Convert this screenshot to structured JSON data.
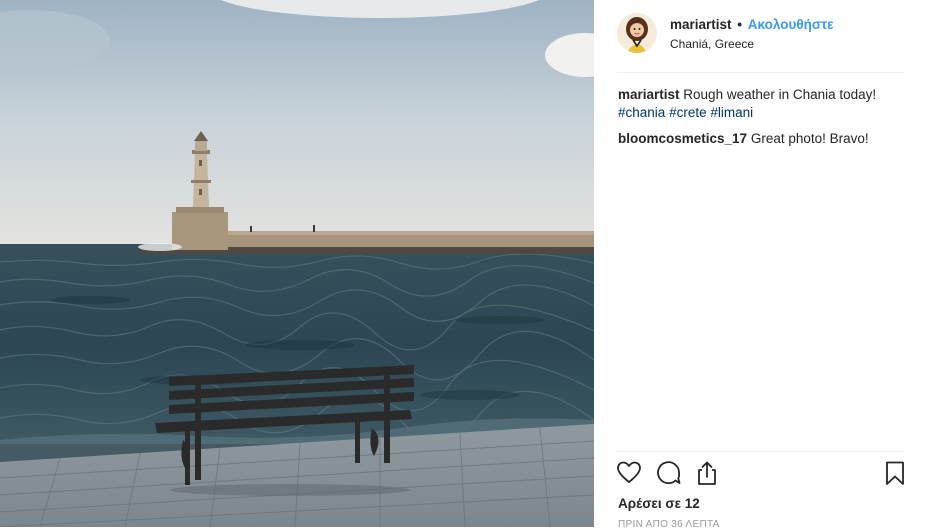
{
  "post": {
    "author": "mariartist",
    "follow_label": "Ακολουθήστε",
    "separator": "•",
    "location": "Chaniá, Greece"
  },
  "comments": [
    {
      "user": "mariartist",
      "text": "Rough weather in Chania today!",
      "tags": [
        "#chania",
        "#crete",
        "#limani"
      ]
    },
    {
      "user": "bloomcosmetics_17",
      "text": "Great photo! Bravo!"
    }
  ],
  "likes_label": "Αρέσει σε 12",
  "timestamp": "ΠΡΙΝ ΑΠΟ 36 ΛΕΠΤΑ",
  "icons": {
    "like": "heart-icon",
    "comment": "comment-bubble-icon",
    "share": "share-icon",
    "save": "bookmark-icon"
  },
  "colors": {
    "link": "#3897f0",
    "hashtag": "#003569",
    "text": "#262626",
    "muted": "#999999"
  }
}
